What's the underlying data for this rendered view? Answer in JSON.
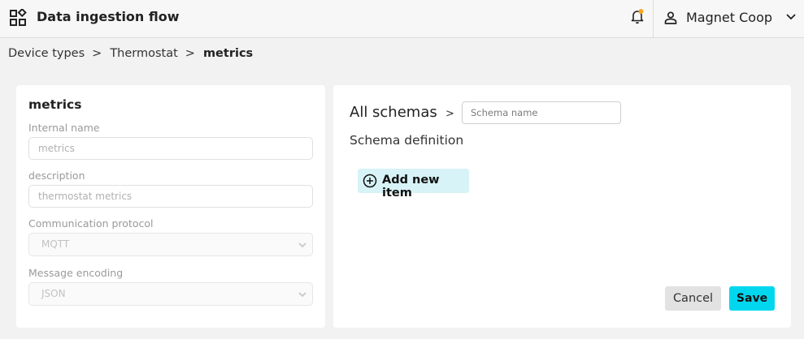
{
  "header": {
    "app_title": "Data ingestion flow",
    "app_icon": "widgets-icon",
    "bell_icon": "bell-icon",
    "notification_dot_color": "#f5a623",
    "user_name": "Magnet Coop",
    "user_icon": "person-icon",
    "caret_icon": "chevron-down-icon"
  },
  "breadcrumb": {
    "items": [
      "Device types",
      "Thermostat"
    ],
    "separator": ">",
    "current": "metrics"
  },
  "form": {
    "title": "metrics",
    "internal_name": {
      "label": "Internal name",
      "value": "metrics"
    },
    "description": {
      "label": "description",
      "value": "thermostat metrics"
    },
    "communication_protocol": {
      "label": "Communication protocol",
      "value": "MQTT"
    },
    "message_encoding": {
      "label": "Message encoding",
      "value": "JSON"
    }
  },
  "schema": {
    "all_schemas_label": "All schemas",
    "separator": ">",
    "name_placeholder": "Schema name",
    "definition_label": "Schema definition",
    "add_item_label": "Add new item",
    "add_item_icon": "plus-circle-icon"
  },
  "actions": {
    "cancel_label": "Cancel",
    "save_label": "Save",
    "save_color": "#00d7ef"
  }
}
